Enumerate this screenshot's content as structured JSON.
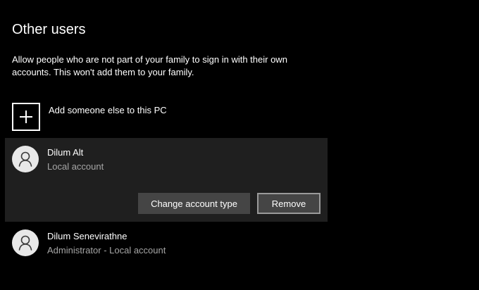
{
  "section": {
    "title": "Other users",
    "description": "Allow people who are not part of your family to sign in with their own accounts. This won't add them to your family."
  },
  "add_user": {
    "label": "Add someone else to this PC",
    "icon": "plus-icon"
  },
  "users": [
    {
      "name": "Dilum Alt",
      "account_type": "Local account",
      "icon": "person-icon",
      "selected": true,
      "actions": {
        "change_label": "Change account type",
        "remove_label": "Remove"
      }
    },
    {
      "name": "Dilum Senevirathne",
      "account_type": "Administrator - Local account",
      "icon": "person-icon",
      "selected": false
    }
  ],
  "colors": {
    "background": "#000000",
    "selected_card": "#1f1f1f",
    "button": "#454545",
    "secondary_text": "#a6a6a6"
  }
}
